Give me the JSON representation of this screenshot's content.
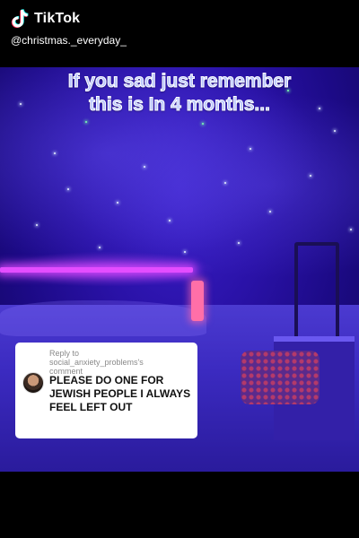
{
  "app": {
    "logo_text": "TikTok",
    "logo_icon": "tiktok-note-icon",
    "handle": "@christmas._everyday_"
  },
  "video": {
    "caption_lines": [
      "If you sad just remember",
      "this is In 4 months..."
    ]
  },
  "reply_sticker": {
    "label_line1": "Reply to",
    "label_line2": "social_anxiety_problems's",
    "label_line3": "comment",
    "comment_text": "PLEASE DO ONE FOR JEWISH PEOPLE I ALWAYS FEEL LEFT OUT"
  },
  "colors": {
    "scene_accent": "#2a12a8",
    "led": "#e34dff",
    "caption": "#b9c6ff"
  }
}
